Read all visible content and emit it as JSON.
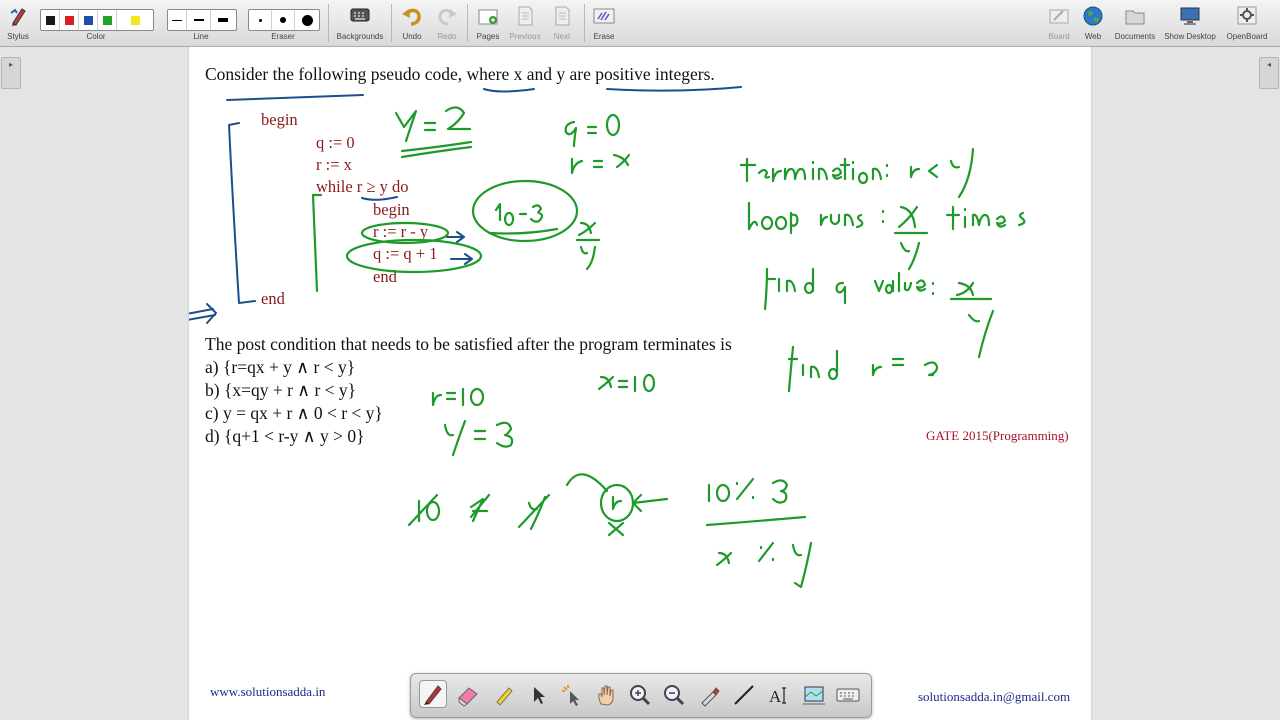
{
  "toolbar": {
    "stylus": "Stylus",
    "color": "Color",
    "line": "Line",
    "eraser": "Eraser",
    "backgrounds": "Backgrounds",
    "undo": "Undo",
    "redo": "Redo",
    "pages": "Pages",
    "previous": "Previous",
    "next": "Next",
    "erase": "Erase",
    "board": "Board",
    "web": "Web",
    "documents": "Documents",
    "show_desktop": "Show Desktop",
    "openboard": "OpenBoard",
    "colors": [
      "#1a1a1a",
      "#d81e1e",
      "#1f4fa8",
      "#1fa32a",
      "#f5e51a"
    ]
  },
  "slide": {
    "question_line": "Consider the following pseudo code, where x and y are positive integers.",
    "code": {
      "begin": "begin",
      "q_init": "q := 0",
      "r_init": "r := x",
      "while": "while r ≥ y do",
      "inner_begin": "begin",
      "r_update": "r := r - y",
      "q_update": "q := q + 1",
      "inner_end": "end",
      "end": "end"
    },
    "post_condition": "The post condition that needs to be satisfied after the program terminates is",
    "options": [
      "a)  {r=qx + y  ∧  r < y}",
      "b)  {x=qy + r  ∧  r < y}",
      "c)  y = qx + r  ∧   0  < r < y}",
      "d)  {q+1 < r-y  ∧  y > 0}"
    ],
    "source_tag": "GATE 2015(Programming)",
    "footer_left": "www.solutionsadda.in",
    "footer_right": "solutionsadda.in@gmail.com"
  },
  "annotations": {
    "ink_color": "#1e9a2a",
    "blue_ink_color": "#1b4f8c",
    "handwritten": [
      "y = 2",
      "q = 0",
      "r = x",
      "10 - 3",
      "x/y",
      "termination : r < y",
      "loop runs : x/y times",
      "find q value : x/y",
      "find r = ?",
      "r = 10",
      "y = 3",
      "x = 10",
      "10 ≯ y",
      "10 % 3",
      "x % y"
    ]
  },
  "bottom_tools": [
    "pen-icon",
    "eraser-icon",
    "highlighter-icon",
    "pointer-icon",
    "laser-icon",
    "hand-icon",
    "zoom-in-icon",
    "zoom-out-icon",
    "color-picker-icon",
    "line-icon",
    "text-icon",
    "capture-icon",
    "keyboard-icon"
  ]
}
